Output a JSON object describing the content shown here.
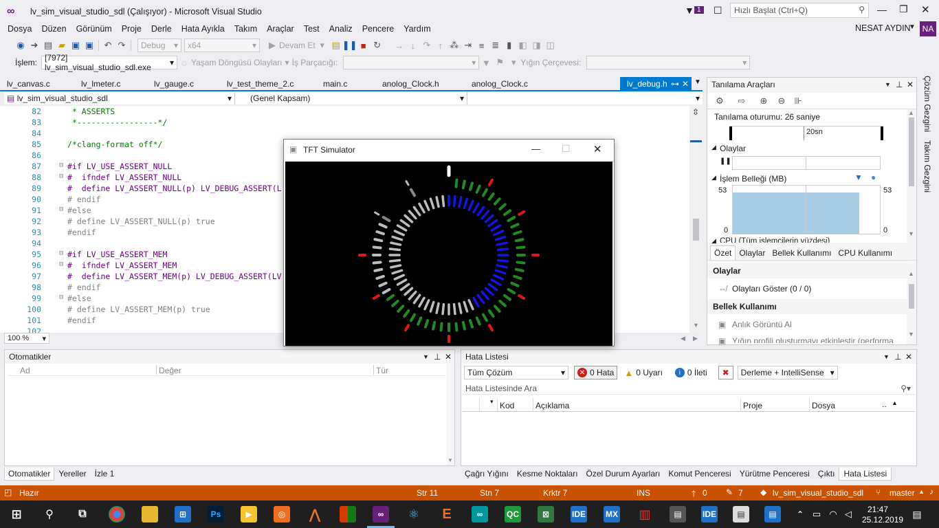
{
  "window": {
    "title": "lv_sim_visual_studio_sdl (Çalışıyor) - Microsoft Visual Studio",
    "notif_count": "1",
    "quick_launch_placeholder": "Hızlı Başlat (Ctrl+Q)",
    "user_name": "NESAT AYDIN",
    "user_initials": "NA"
  },
  "menu": [
    "Dosya",
    "Düzen",
    "Görünüm",
    "Proje",
    "Derle",
    "Hata Ayıkla",
    "Takım",
    "Araçlar",
    "Test",
    "Analiz",
    "Pencere",
    "Yardım"
  ],
  "toolbar": {
    "config": "Debug",
    "platform": "x64",
    "continue_label": "Devam Et"
  },
  "toolbar2": {
    "process_label": "İşlem:",
    "process_value": "[7972] lv_sim_visual_studio_sdl.exe",
    "lifecycle_label": "Yaşam Döngüsü Olayları",
    "thread_label": "İş Parçacığı:",
    "stack_label": "Yığın Çerçevesi:"
  },
  "tabs": [
    "lv_canvas.c",
    "lv_lmeter.c",
    "lv_gauge.c",
    "lv_test_theme_2.c",
    "main.c",
    "anolog_Clock.h",
    "anolog_Clock.c",
    "lv_debug.h"
  ],
  "nav": {
    "project": "lv_sim_visual_studio_sdl",
    "scope": "(Genel Kapsam)"
  },
  "code_lines": [
    {
      "n": "82",
      "t": " * ASSERTS"
    },
    {
      "n": "83",
      "t": " *-----------------*/"
    },
    {
      "n": "84",
      "t": ""
    },
    {
      "n": "85",
      "t": "/*clang-format off*/"
    },
    {
      "n": "86",
      "t": ""
    },
    {
      "n": "87",
      "t": "#if LV_USE_ASSERT_NULL"
    },
    {
      "n": "88",
      "t": "#  ifndef LV_ASSERT_NULL"
    },
    {
      "n": "89",
      "t": "#  define LV_ASSERT_NULL(p) LV_DEBUG_ASSERT(L"
    },
    {
      "n": "90",
      "t": "# endif"
    },
    {
      "n": "91",
      "t": "#else"
    },
    {
      "n": "92",
      "t": "# define LV_ASSERT_NULL(p) true"
    },
    {
      "n": "93",
      "t": "#endif"
    },
    {
      "n": "94",
      "t": ""
    },
    {
      "n": "95",
      "t": "#if LV_USE_ASSERT_MEM"
    },
    {
      "n": "96",
      "t": "#  ifndef LV_ASSERT_MEM"
    },
    {
      "n": "97",
      "t": "#  define LV_ASSERT_MEM(p) LV_DEBUG_ASSERT(LV"
    },
    {
      "n": "98",
      "t": "# endif"
    },
    {
      "n": "99",
      "t": "#else"
    },
    {
      "n": "100",
      "t": "# define LV_ASSERT_MEM(p) true"
    },
    {
      "n": "101",
      "t": "#endif"
    },
    {
      "n": "102",
      "t": ""
    }
  ],
  "zoom": "100 %",
  "tft": {
    "title": "TFT Simulator"
  },
  "diag": {
    "title": "Tanılama Araçları",
    "session": "Tanılama oturumu: 26 saniye",
    "time_mark": "20sn",
    "events": "Olaylar",
    "mem_title": "İşlem Belleği (MB)",
    "mem_max": "53",
    "mem_min": "0",
    "mem_value": 53,
    "cpu_title": "CPU (Tüm işlemcilerin yüzdesi)",
    "tabs": [
      "Özet",
      "Olaylar",
      "Bellek Kullanımı",
      "CPU Kullanımı"
    ],
    "events_hdr": "Olaylar",
    "show_events": "Olayları Göster (0 / 0)",
    "memory_hdr": "Bellek Kullanımı",
    "snapshot": "Anlık Görüntü Al",
    "heap": "Yığın profili oluşturmayı etkinleştir (performa"
  },
  "side_tabs": [
    "Çözüm Gezgini",
    "Takım Gezgini"
  ],
  "autos": {
    "title": "Otomatikler",
    "cols": [
      "Ad",
      "Değer",
      "Tür"
    ],
    "tabs": [
      "Otomatikler",
      "Yereller",
      "İzle 1"
    ]
  },
  "errors": {
    "title": "Hata Listesi",
    "scope": "Tüm Çözüm",
    "err": "0 Hata",
    "warn": "0 Uyarı",
    "msg": "0 İleti",
    "build": "Derleme + IntelliSense",
    "search": "Hata Listesinde Ara",
    "cols": [
      "Kod",
      "Açıklama",
      "Proje",
      "Dosya"
    ],
    "tabs": [
      "Çağrı Yığını",
      "Kesme Noktaları",
      "Özel Durum Ayarları",
      "Komut Penceresi",
      "Yürütme Penceresi",
      "Çıktı",
      "Hata Listesi"
    ]
  },
  "status": {
    "ready": "Hazır",
    "line": "Str 11",
    "col": "Stn 7",
    "ch": "Krktr 7",
    "ins": "INS",
    "up": "0",
    "edits": "7",
    "repo": "lv_sim_visual_studio_sdl",
    "branch": "master"
  },
  "taskbar": {
    "time": "21:47",
    "date": "25.12.2019"
  },
  "colors": {
    "accent": "#007acc",
    "status": "#ca5100",
    "gauge_green": "#1e8c1e",
    "gauge_blue": "#1414e6",
    "gauge_red": "#e61414"
  }
}
